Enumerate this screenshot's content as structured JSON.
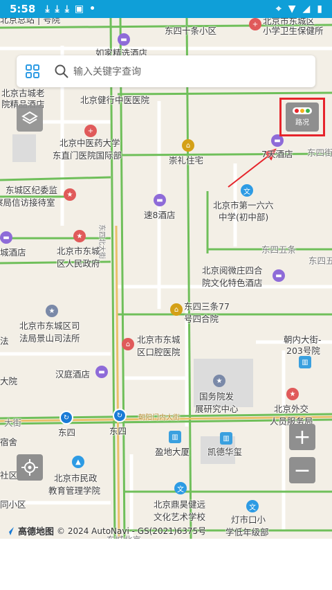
{
  "status_bar": {
    "time": "5:58",
    "left_icons": [
      "download-icon",
      "download-icon",
      "download-icon",
      "text-icon",
      "dot-icon"
    ],
    "right_icons": [
      "location-icon",
      "wifi-icon",
      "signal-icon",
      "battery-icon"
    ]
  },
  "search": {
    "placeholder": "输入关键字查询"
  },
  "traffic_button": {
    "label": "路况"
  },
  "zoom": {
    "in": "+",
    "out": "−"
  },
  "attribution": {
    "logo": "高德地图",
    "copyright": "© 2024 AutoNavi - GS(2021)6375号"
  },
  "map_labels": {
    "l01": "北京总站 | 号院",
    "l02": "东四十条小区",
    "l03": "北京市东城区",
    "l04": "小学卫生保健所",
    "l05": "如家精选酒店",
    "l06": "北京古城老",
    "l07": "院精品酒店",
    "l08": "北京健行中医医院",
    "l09": "北京中医药大学",
    "l10": "东直门医院国际部",
    "l11": "崇礼住宅",
    "l12": "7天酒店",
    "l13": "东四街",
    "l14": "东城区纪委监",
    "l15": "察局信访接待室",
    "l16": "速8酒店",
    "l17": "北京市第一六六",
    "l18": "中学(初中部)",
    "l19": "北京市东城",
    "l20": "区人民政府",
    "l21": "城酒店",
    "l22": "东四五条",
    "l23": "北京阅微庄四合",
    "l24": "院文化特色酒店",
    "l25": "东四五",
    "l26": "东四三条77",
    "l27": "号四合院",
    "l28": "北京市东城区司",
    "l29": "法局景山司法所",
    "l30": "北京市东城",
    "l31": "区口腔医院",
    "l32": "朝内大街-",
    "l33": "203号院",
    "l34": "汉庭酒店",
    "l35": "国务院发",
    "l36": "展研究中心",
    "l37": "北京外交",
    "l38": "人员服务局",
    "l39": "大街",
    "l40": "东四",
    "l41": "东四",
    "l42": "宿舍",
    "l43": "盈地大厦",
    "l44": "凯德华玺",
    "l45": "北京市民政",
    "l46": "教育管理学院",
    "l47": "社区",
    "l48": "同小区",
    "l49": "北京鼎昊健远",
    "l50": "文化艺术学校",
    "l51": "灯市口小",
    "l52": "学低年级部",
    "l53": "大院",
    "l54": "法",
    "l55": "东城北京",
    "l56": "东四北大街",
    "l57": "朝阳门内大街"
  },
  "colors": {
    "status_bar": "#0f9fd8",
    "map_bg": "#f3efe6",
    "road_green": "#6fbf5a",
    "highlight_red": "#e6242b"
  }
}
